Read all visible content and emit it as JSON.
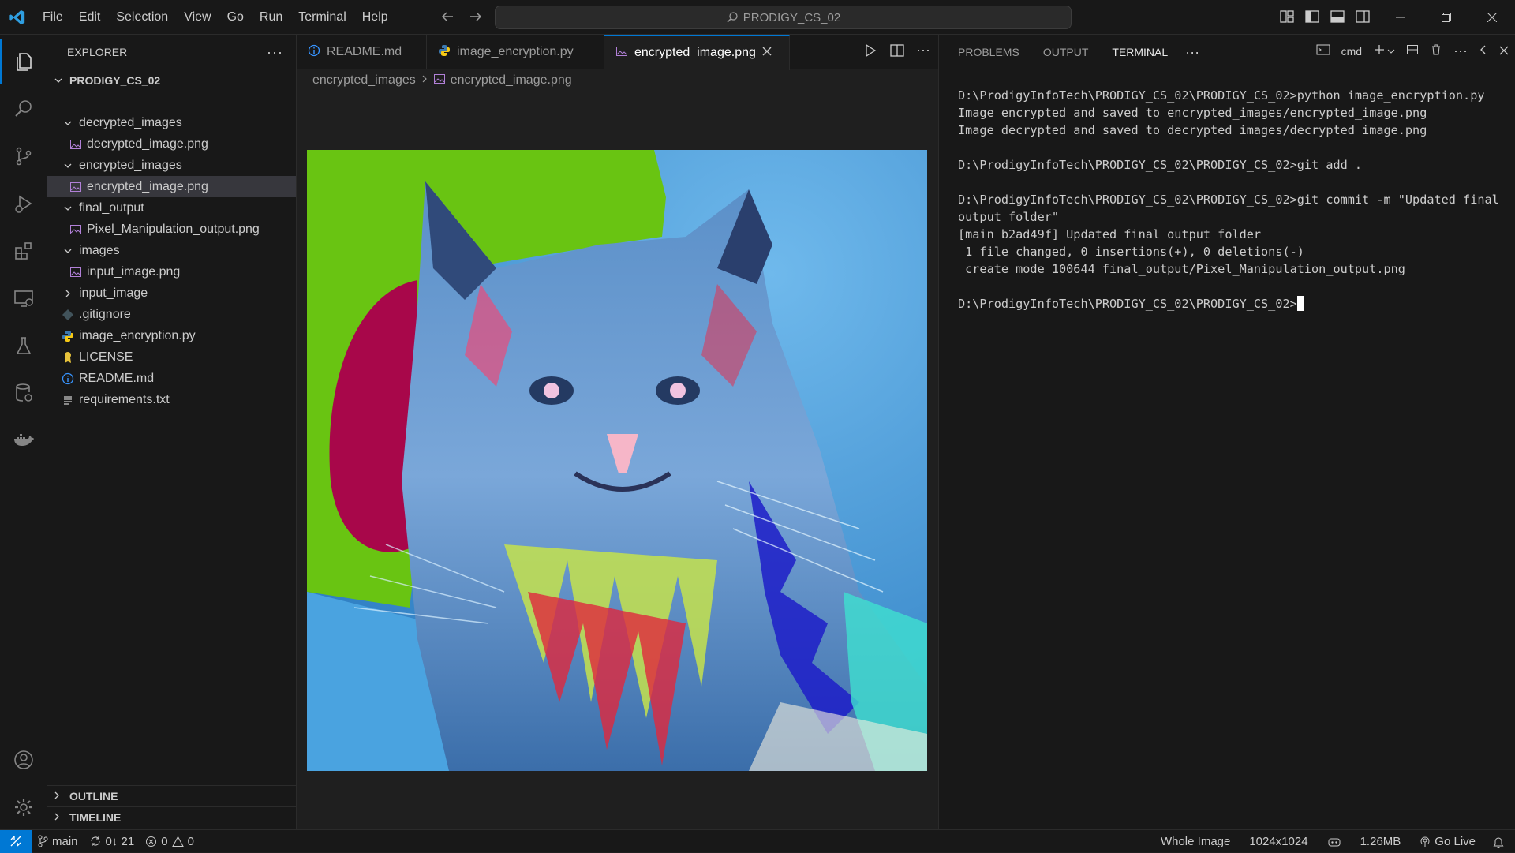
{
  "menu": [
    "File",
    "Edit",
    "Selection",
    "View",
    "Go",
    "Run",
    "Terminal",
    "Help"
  ],
  "command_center": "PRODIGY_CS_02",
  "explorer": {
    "title": "EXPLORER",
    "root": "PRODIGY_CS_02",
    "items": [
      {
        "label": "decrypted_images",
        "type": "folder-open"
      },
      {
        "label": "decrypted_image.png",
        "type": "image"
      },
      {
        "label": "encrypted_images",
        "type": "folder-open"
      },
      {
        "label": "encrypted_image.png",
        "type": "image"
      },
      {
        "label": "final_output",
        "type": "folder-open"
      },
      {
        "label": "Pixel_Manipulation_output.png",
        "type": "image"
      },
      {
        "label": "images",
        "type": "folder-open"
      },
      {
        "label": "input_image.png",
        "type": "image"
      },
      {
        "label": "input_image",
        "type": "folder-closed"
      },
      {
        "label": ".gitignore",
        "type": "gitignore"
      },
      {
        "label": "image_encryption.py",
        "type": "python"
      },
      {
        "label": "LICENSE",
        "type": "license"
      },
      {
        "label": "README.md",
        "type": "info"
      },
      {
        "label": "requirements.txt",
        "type": "text"
      }
    ],
    "outline": "OUTLINE",
    "timeline": "TIMELINE"
  },
  "tabs": [
    {
      "label": "README.md",
      "icon": "info-icon"
    },
    {
      "label": "image_encryption.py",
      "icon": "python-icon"
    },
    {
      "label": "encrypted_image.png",
      "icon": "image-icon"
    }
  ],
  "breadcrumb": {
    "folder": "encrypted_images",
    "file": "encrypted_image.png"
  },
  "panel": {
    "tabs": [
      "PROBLEMS",
      "OUTPUT",
      "TERMINAL"
    ],
    "shell": "cmd",
    "lines": [
      "D:\\ProdigyInfoTech\\PRODIGY_CS_02\\PRODIGY_CS_02>python image_encryption.py",
      "Image encrypted and saved to encrypted_images/encrypted_image.png",
      "Image decrypted and saved to decrypted_images/decrypted_image.png",
      "",
      "D:\\ProdigyInfoTech\\PRODIGY_CS_02\\PRODIGY_CS_02>git add .",
      "",
      "D:\\ProdigyInfoTech\\PRODIGY_CS_02\\PRODIGY_CS_02>git commit -m \"Updated final",
      "output folder\"",
      "[main b2ad49f] Updated final output folder",
      " 1 file changed, 0 insertions(+), 0 deletions(-)",
      " create mode 100644 final_output/Pixel_Manipulation_output.png",
      ""
    ],
    "prompt": "D:\\ProdigyInfoTech\\PRODIGY_CS_02\\PRODIGY_CS_02>"
  },
  "status": {
    "branch": "main",
    "sync": "0↓ 21",
    "errors": "0",
    "warnings": "0",
    "zoom_mode": "Whole Image",
    "dimensions": "1024x1024",
    "size": "1.26MB",
    "golive": "Go Live"
  },
  "colors": {
    "accent": "#0078d4",
    "bg": "#1f1f1f",
    "chrome": "#181818"
  }
}
